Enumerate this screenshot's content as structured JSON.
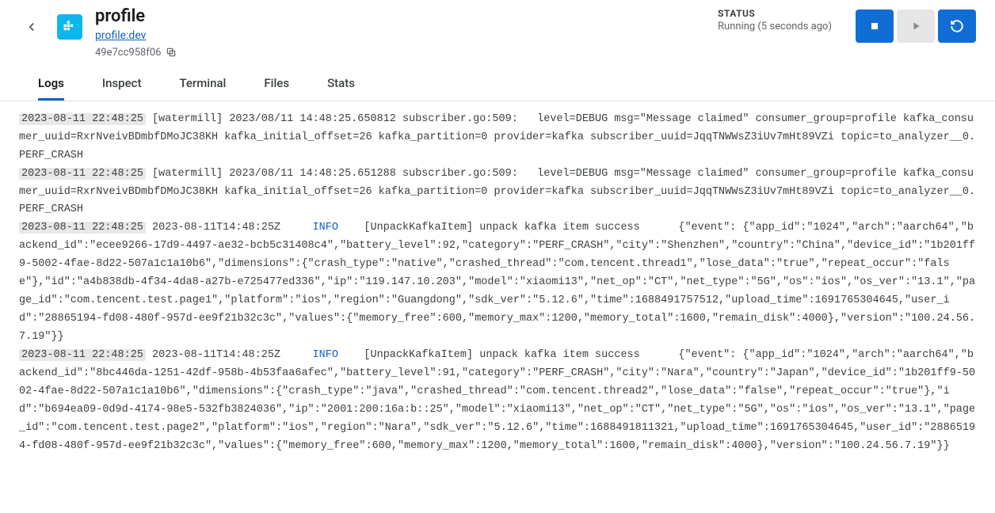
{
  "header": {
    "title": "profile",
    "subtitle": "profile:dev",
    "hash": "49e7cc958f06"
  },
  "status": {
    "label": "STATUS",
    "value": "Running (5 seconds ago)"
  },
  "tabs": {
    "logs": "Logs",
    "inspect": "Inspect",
    "terminal": "Terminal",
    "files": "Files",
    "stats": "Stats"
  },
  "logs": [
    {
      "ts": "2023-08-11 22:48:25",
      "body": " [watermill] 2023/08/11 14:48:25.650812 subscriber.go:509:   level=DEBUG msg=\"Message claimed\" consumer_group=profile kafka_consumer_uuid=RxrNveivBDmbfDMoJC38KH kafka_initial_offset=26 kafka_partition=0 provider=kafka subscriber_uuid=JqqTNWWsZ3iUv7mHt89VZi topic=to_analyzer__0.PERF_CRASH"
    },
    {
      "ts": "2023-08-11 22:48:25",
      "body": " [watermill] 2023/08/11 14:48:25.651288 subscriber.go:509:   level=DEBUG msg=\"Message claimed\" consumer_group=profile kafka_consumer_uuid=RxrNveivBDmbfDMoJC38KH kafka_initial_offset=26 kafka_partition=0 provider=kafka subscriber_uuid=JqqTNWWsZ3iUv7mHt89VZi topic=to_analyzer__0.PERF_CRASH"
    },
    {
      "ts": "2023-08-11 22:48:25",
      "pre": " 2023-08-11T14:48:25Z     ",
      "level": "INFO",
      "body": "    [UnpackKafkaItem] unpack kafka item success      {\"event\": {\"app_id\":\"1024\",\"arch\":\"aarch64\",\"backend_id\":\"ecee9266-17d9-4497-ae32-bcb5c31408c4\",\"battery_level\":92,\"category\":\"PERF_CRASH\",\"city\":\"Shenzhen\",\"country\":\"China\",\"device_id\":\"1b201ff9-5002-4fae-8d22-507a1c1a10b6\",\"dimensions\":{\"crash_type\":\"native\",\"crashed_thread\":\"com.tencent.thread1\",\"lose_data\":\"true\",\"repeat_occur\":\"false\"},\"id\":\"a4b838db-4f34-4da8-a27b-e725477ed336\",\"ip\":\"119.147.10.203\",\"model\":\"xiaomi13\",\"net_op\":\"CT\",\"net_type\":\"5G\",\"os\":\"ios\",\"os_ver\":\"13.1\",\"page_id\":\"com.tencent.test.page1\",\"platform\":\"ios\",\"region\":\"Guangdong\",\"sdk_ver\":\"5.12.6\",\"time\":1688491757512,\"upload_time\":1691765304645,\"user_id\":\"28865194-fd08-480f-957d-ee9f21b32c3c\",\"values\":{\"memory_free\":600,\"memory_max\":1200,\"memory_total\":1600,\"remain_disk\":4000},\"version\":\"100.24.56.7.19\"}}"
    },
    {
      "ts": "2023-08-11 22:48:25",
      "pre": " 2023-08-11T14:48:25Z     ",
      "level": "INFO",
      "body": "    [UnpackKafkaItem] unpack kafka item success      {\"event\": {\"app_id\":\"1024\",\"arch\":\"aarch64\",\"backend_id\":\"8bc446da-1251-42df-958b-4b53faa6afec\",\"battery_level\":91,\"category\":\"PERF_CRASH\",\"city\":\"Nara\",\"country\":\"Japan\",\"device_id\":\"1b201ff9-5002-4fae-8d22-507a1c1a10b6\",\"dimensions\":{\"crash_type\":\"java\",\"crashed_thread\":\"com.tencent.thread2\",\"lose_data\":\"false\",\"repeat_occur\":\"true\"},\"id\":\"b694ea09-0d9d-4174-98e5-532fb3824036\",\"ip\":\"2001:200:16a:b::25\",\"model\":\"xiaomi13\",\"net_op\":\"CT\",\"net_type\":\"5G\",\"os\":\"ios\",\"os_ver\":\"13.1\",\"page_id\":\"com.tencent.test.page2\",\"platform\":\"ios\",\"region\":\"Nara\",\"sdk_ver\":\"5.12.6\",\"time\":1688491811321,\"upload_time\":1691765304645,\"user_id\":\"28865194-fd08-480f-957d-ee9f21b32c3c\",\"values\":{\"memory_free\":600,\"memory_max\":1200,\"memory_total\":1600,\"remain_disk\":4000},\"version\":\"100.24.56.7.19\"}}"
    }
  ]
}
